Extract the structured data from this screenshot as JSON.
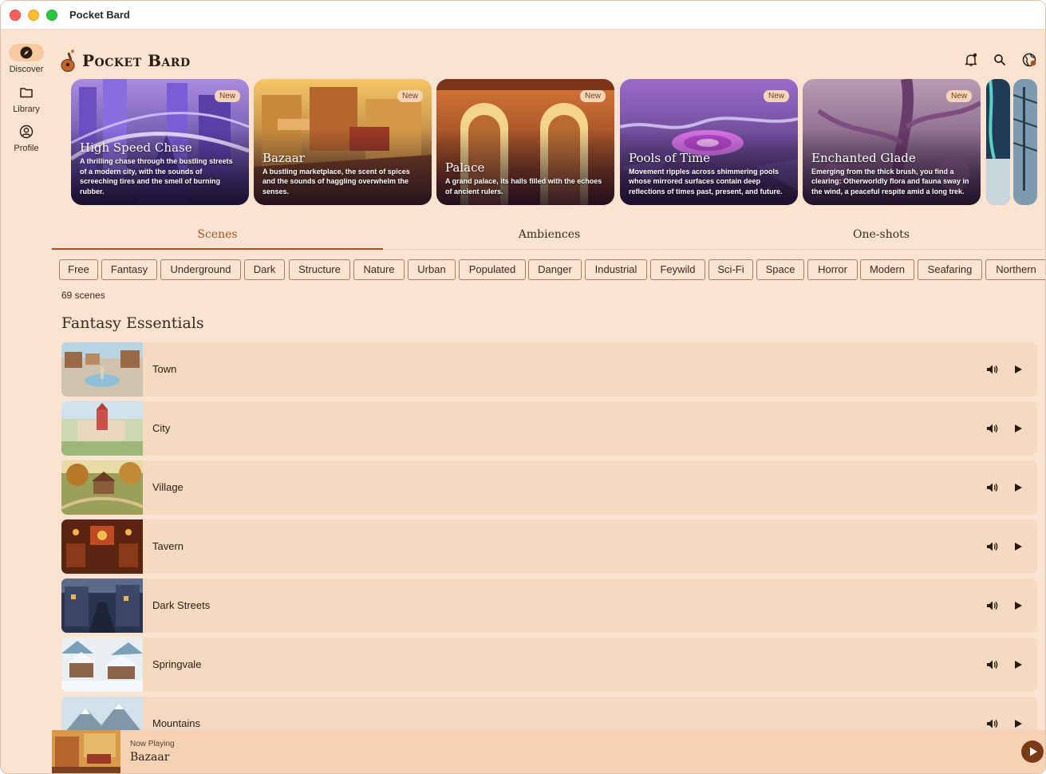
{
  "window": {
    "title": "Pocket Bard"
  },
  "app": {
    "name": "Pocket Bard"
  },
  "sidebar": {
    "items": [
      {
        "label": "Discover",
        "icon": "compass-icon",
        "active": true
      },
      {
        "label": "Library",
        "icon": "folder-icon",
        "active": false
      },
      {
        "label": "Profile",
        "icon": "user-circle-icon",
        "active": false
      }
    ]
  },
  "header": {
    "icons": [
      "bell-icon",
      "search-icon",
      "globe-icon"
    ]
  },
  "featured": [
    {
      "badge": "New",
      "title": "High Speed Chase",
      "description": "A thrilling chase through the bustling streets of a modern city, with the sounds of screeching tires and the smell of burning rubber."
    },
    {
      "badge": "New",
      "title": "Bazaar",
      "description": "A bustling marketplace, the scent of spices and the sounds of haggling overwhelm the senses."
    },
    {
      "badge": "New",
      "title": "Palace",
      "description": "A grand palace, its halls filled with the echoes of ancient rulers."
    },
    {
      "badge": "New",
      "title": "Pools of Time",
      "description": "Movement ripples across shimmering pools whose mirrored surfaces contain deep reflections of times past, present, and future."
    },
    {
      "badge": "New",
      "title": "Enchanted Glade",
      "description": "Emerging from the thick brush, you find a clearing: Otherworldly flora and fauna sway in the wind, a peaceful respite amid a long trek."
    }
  ],
  "tabs": [
    {
      "label": "Scenes",
      "active": true
    },
    {
      "label": "Ambiences",
      "active": false
    },
    {
      "label": "One-shots",
      "active": false
    }
  ],
  "filters": [
    "Free",
    "Fantasy",
    "Underground",
    "Dark",
    "Structure",
    "Nature",
    "Urban",
    "Populated",
    "Danger",
    "Industrial",
    "Feywild",
    "Sci-Fi",
    "Space",
    "Horror",
    "Modern",
    "Seafaring",
    "Northern"
  ],
  "scene_count": "69 scenes",
  "section": {
    "title": "Fantasy Essentials"
  },
  "scenes": [
    {
      "name": "Town"
    },
    {
      "name": "City"
    },
    {
      "name": "Village"
    },
    {
      "name": "Tavern"
    },
    {
      "name": "Dark Streets"
    },
    {
      "name": "Springvale"
    },
    {
      "name": "Mountains"
    }
  ],
  "now_playing": {
    "label": "Now Playing",
    "title": "Bazaar"
  },
  "colors": {
    "background": "#fbe3d1",
    "accent": "#a8521e",
    "row": "#f6d9c1",
    "chip_border": "#a67d5f"
  }
}
